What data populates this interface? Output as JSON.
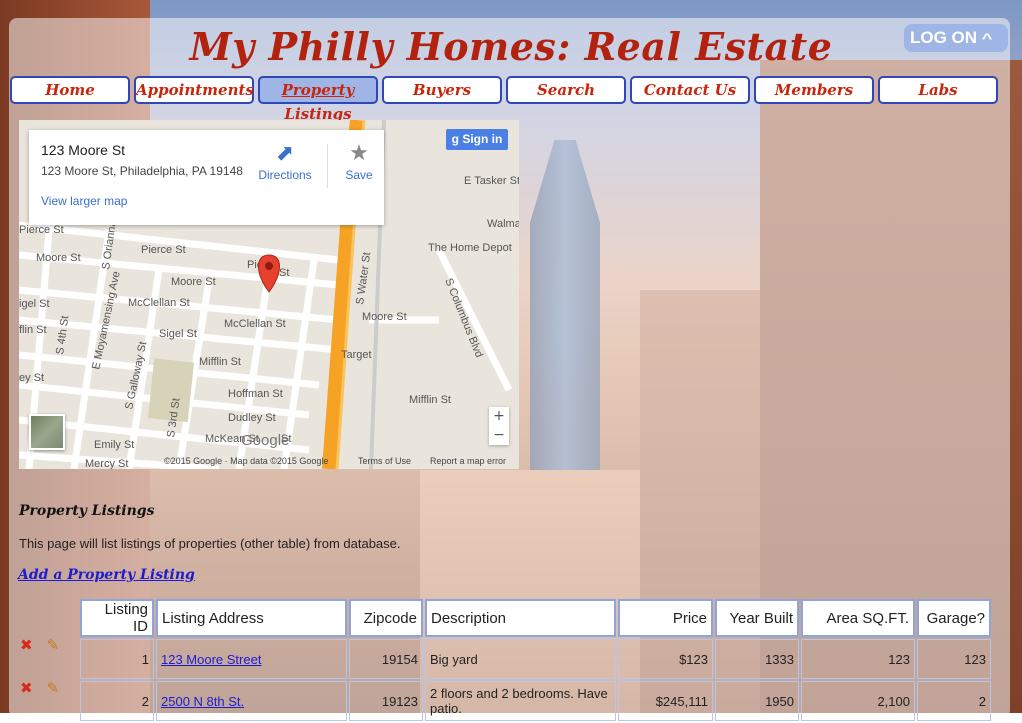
{
  "header": {
    "title": "My Philly Homes: Real Estate",
    "logon_label": "LOG ON"
  },
  "nav": {
    "items": [
      {
        "label": "Home"
      },
      {
        "label": "Appointments"
      },
      {
        "label": "Property Listings",
        "active": true
      },
      {
        "label": "Buyers"
      },
      {
        "label": "Search"
      },
      {
        "label": "Contact Us"
      },
      {
        "label": "Members"
      },
      {
        "label": "Labs"
      }
    ]
  },
  "map": {
    "place_name": "123 Moore St",
    "place_address": "123 Moore St, Philadelphia, PA 19148",
    "view_larger": "View larger map",
    "directions": "Directions",
    "save": "Save",
    "signin": "Sign in",
    "zoom_in": "+",
    "zoom_out": "−",
    "google_logo": "Google",
    "footer_copy": "©2015 Google · Map data ©2015 Google",
    "footer_terms": "Terms of Use",
    "footer_report": "Report a map error",
    "labels": [
      "E Tasker St",
      "Walma",
      "The Home Depot",
      "Pierce St",
      "Pierce St",
      "Moore St",
      "Moore St",
      "Pie",
      "St",
      "McClellan St",
      "McClellan St",
      "Sigel St",
      "Sigel St",
      "Mifflin St",
      "Mifflin St",
      "Hoffman St",
      "Dudley St",
      "McKean St",
      "Emily St",
      "Mercy St",
      "Moore St",
      "Target",
      "S Water St",
      "S Columbus Blvd",
      "S 4th St",
      "S 3rd St",
      "E Moyamensing Ave",
      "S Orianna",
      "S Galloway St",
      "St",
      "ey St",
      "flin St",
      "igel St"
    ]
  },
  "content": {
    "heading": "Property Listings",
    "description": "This page will list listings of properties (other table) from database.",
    "add_link": "Add a Property Listing"
  },
  "table": {
    "columns": [
      "Listing ID",
      "Listing Address",
      "Zipcode",
      "Description",
      "Price",
      "Year Built",
      "Area SQ.FT.",
      "Garage?"
    ],
    "rows": [
      {
        "id": "1",
        "address": "123 Moore Street",
        "zipcode": "19154",
        "description": "Big yard",
        "price": "$123",
        "year": "1333",
        "area": "123",
        "garage": "123"
      },
      {
        "id": "2",
        "address": "2500 N 8th St.",
        "zipcode": "19123",
        "description": "2 floors and 2 bedrooms. Have patio.",
        "price": "$245,111",
        "year": "1950",
        "area": "2,100",
        "garage": "2"
      }
    ],
    "delete_icon": "×-delete-icon",
    "edit_icon": "pencil-icon"
  }
}
